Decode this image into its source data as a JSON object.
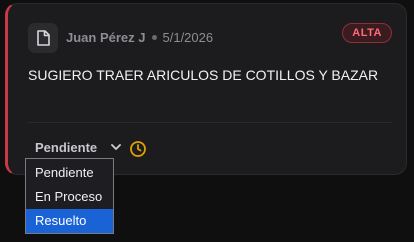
{
  "card": {
    "author": "Juan Pérez J",
    "date": "5/1/2026",
    "priority": "ALTA",
    "message": "SUGIERO TRAER ARICULOS DE COTILLOS Y BAZAR",
    "icon": "document-icon",
    "accent_color": "#c73b46"
  },
  "status": {
    "current": "Pendiente",
    "clock_icon": "clock-icon",
    "clock_color": "#e0a000",
    "options": [
      "Pendiente",
      "En Proceso",
      "Resuelto"
    ],
    "highlighted": "Resuelto"
  }
}
